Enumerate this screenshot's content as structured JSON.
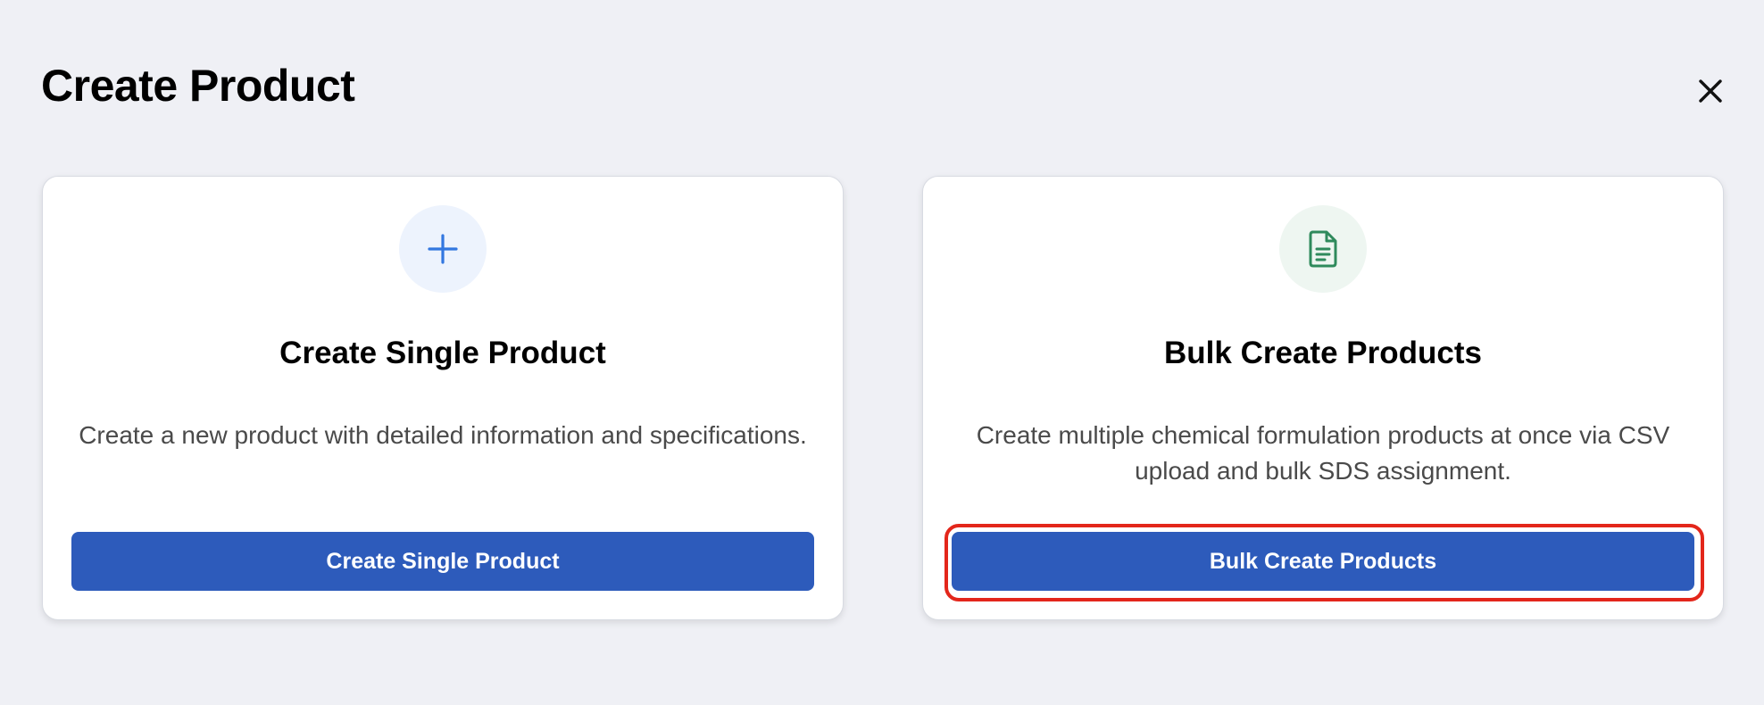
{
  "dialog": {
    "title": "Create Product",
    "close_icon": "close-icon"
  },
  "options": [
    {
      "icon": "plus-icon",
      "icon_color": "#3277e0",
      "title": "Create Single Product",
      "description": "Create a new product with detailed information and specifications.",
      "button_label": "Create Single Product"
    },
    {
      "icon": "document-icon",
      "icon_color": "#2f8a5c",
      "title": "Bulk Create Products",
      "description": "Create multiple chemical formulation products at once via CSV upload and bulk SDS assignment.",
      "button_label": "Bulk Create Products"
    }
  ],
  "colors": {
    "background": "#eff0f5",
    "primary_button": "#2d5bbb",
    "highlight": "#e3261b"
  }
}
